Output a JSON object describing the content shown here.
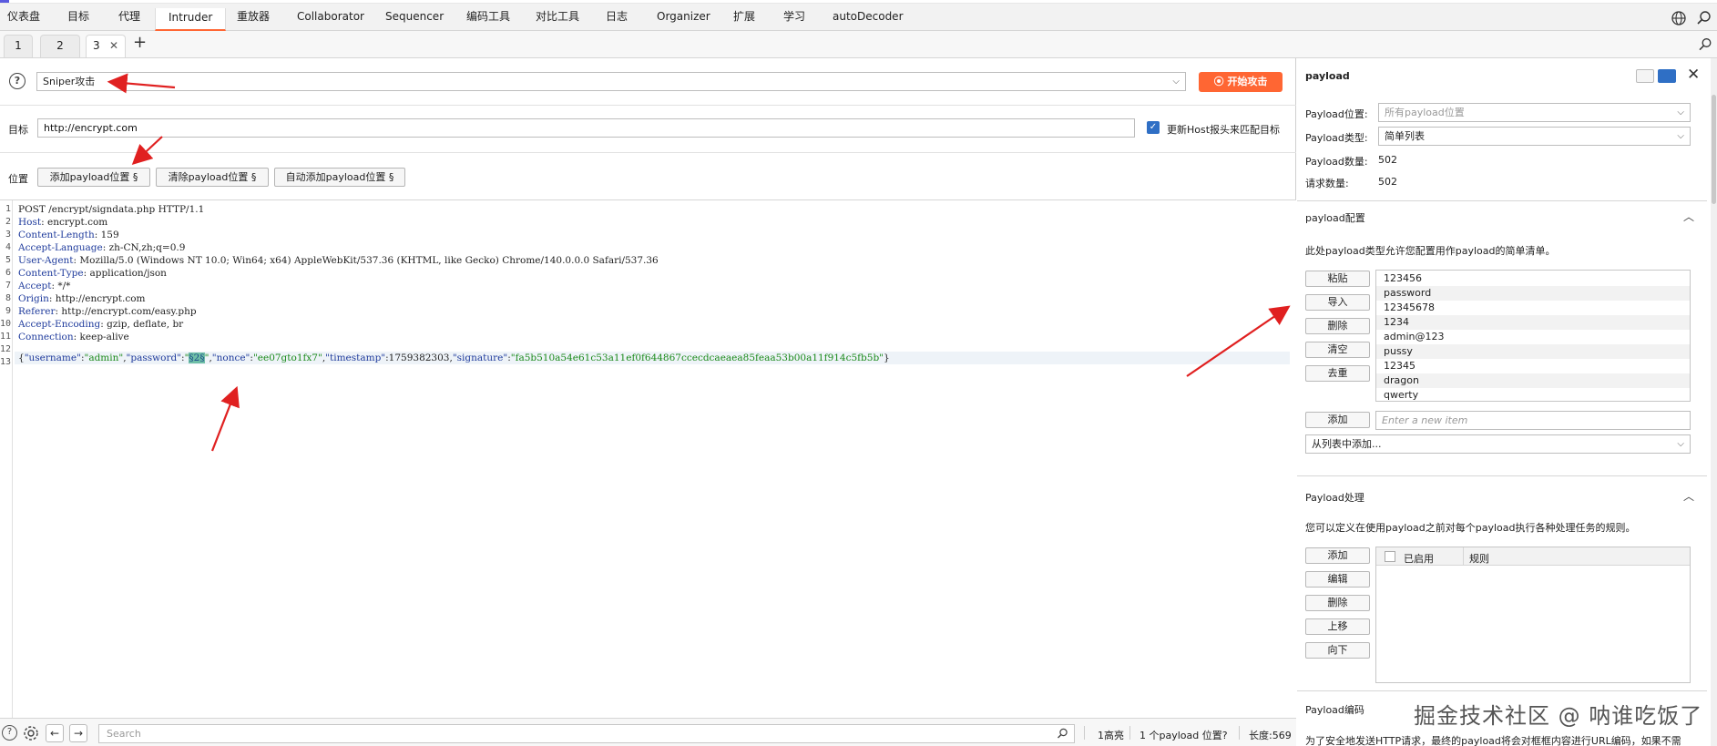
{
  "menu": {
    "items": [
      "仪表盘",
      "目标",
      "代理",
      "Intruder",
      "重放器",
      "Collaborator",
      "Sequencer",
      "编码工具",
      "对比工具",
      "日志",
      "Organizer",
      "扩展",
      "学习",
      "autoDecoder"
    ],
    "active": "Intruder"
  },
  "tabs": [
    "1",
    "2",
    "3"
  ],
  "attack": {
    "type": "Sniper攻击",
    "start_label": "开始攻击"
  },
  "target": {
    "label": "目标",
    "value": "http://encrypt.com",
    "update_host_label": "更新Host报头来匹配目标",
    "update_host_checked": true
  },
  "positions": {
    "label": "位置",
    "add_label": "添加payload位置 §",
    "clear_label": "清除payload位置 §",
    "auto_label": "自动添加payload位置 §"
  },
  "request": {
    "line_numbers": [
      "1",
      "2",
      "3",
      "4",
      "5",
      "6",
      "7",
      "8",
      "9",
      "10",
      "11",
      "12",
      "13"
    ],
    "request_line": "POST /encrypt/signdata.php HTTP/1.1",
    "headers": [
      {
        "name": "Host",
        "value": " encrypt.com"
      },
      {
        "name": "Content-Length",
        "value": " 159"
      },
      {
        "name": "Accept-Language",
        "value": " zh-CN,zh;q=0.9"
      },
      {
        "name": "User-Agent",
        "value": " Mozilla/5.0 (Windows NT 10.0; Win64; x64) AppleWebKit/537.36 (KHTML, like Gecko) Chrome/140.0.0.0 Safari/537.36"
      },
      {
        "name": "Content-Type",
        "value": " application/json"
      },
      {
        "name": "Accept",
        "value": " */*"
      },
      {
        "name": "Origin",
        "value": " http://encrypt.com"
      },
      {
        "name": "Referer",
        "value": " http://encrypt.com/easy.php"
      },
      {
        "name": "Accept-Encoding",
        "value": " gzip, deflate, br"
      },
      {
        "name": "Connection",
        "value": " keep-alive"
      }
    ],
    "body": {
      "p1": "{",
      "k_username": "\"username\"",
      "c1": ":",
      "v_username": "\"admin\"",
      "c2": ",",
      "k_password": "\"password\"",
      "c3": ":",
      "q1": "\"",
      "marker": "§2§",
      "q2": "\"",
      "c4": ",",
      "k_nonce": "\"nonce\"",
      "c5": ":",
      "v_nonce": "\"ee07gto1fx7\"",
      "c6": ",",
      "k_timestamp": "\"timestamp\"",
      "c7": ":",
      "v_timestamp": "1759382303",
      "c8": ",",
      "k_signature": "\"signature\"",
      "c9": ":",
      "v_signature": "\"fa5b510a54e61c53a11ef0f644867ccecdcaeaea85feaa53b00a11f914c5fb5b\"",
      "p2": "}"
    }
  },
  "bottom": {
    "search_placeholder": "Search",
    "highlights": "1高亮",
    "positions_count": "1 个payload 位置?",
    "length": "长度:569"
  },
  "payload_panel": {
    "title": "payload",
    "position_label": "Payload位置:",
    "position_value": "所有payload位置",
    "type_label": "Payload类型:",
    "type_value": "简单列表",
    "count_label": "Payload数量:",
    "count_value": "502",
    "requests_label": "请求数量:",
    "requests_value": "502",
    "config_title": "payload配置",
    "config_desc": "此处payload类型允许您配置用作payload的简单清单。",
    "buttons": [
      "粘贴",
      "导入",
      "删除",
      "清空",
      "去重"
    ],
    "list": [
      "123456",
      "password",
      "12345678",
      "1234",
      "admin@123",
      "pussy",
      "12345",
      "dragon",
      "qwerty"
    ],
    "add_label": "添加",
    "add_placeholder": "Enter a new item",
    "add_from_list": "从列表中添加...",
    "processing_title": "Payload处理",
    "processing_desc": "您可以定义在使用payload之前对每个payload执行各种处理任务的规则。",
    "processing_buttons": [
      "添加",
      "编辑",
      "删除",
      "上移",
      "向下"
    ],
    "col_enabled": "已启用",
    "col_rule": "规则",
    "encoding_title": "Payload编码",
    "encoding_desc": "为了安全地发送HTTP请求，最终的payload将会对框框内容进行URL编码，如果不需"
  },
  "watermark": "掘金技术社区 @ 呐谁吃饭了",
  "colors": {
    "accent": "#ff6633",
    "check": "#2f6fc5",
    "arrow": "#e02020",
    "header_key": "#1f3b9c",
    "json_value": "#1a8a1a"
  }
}
